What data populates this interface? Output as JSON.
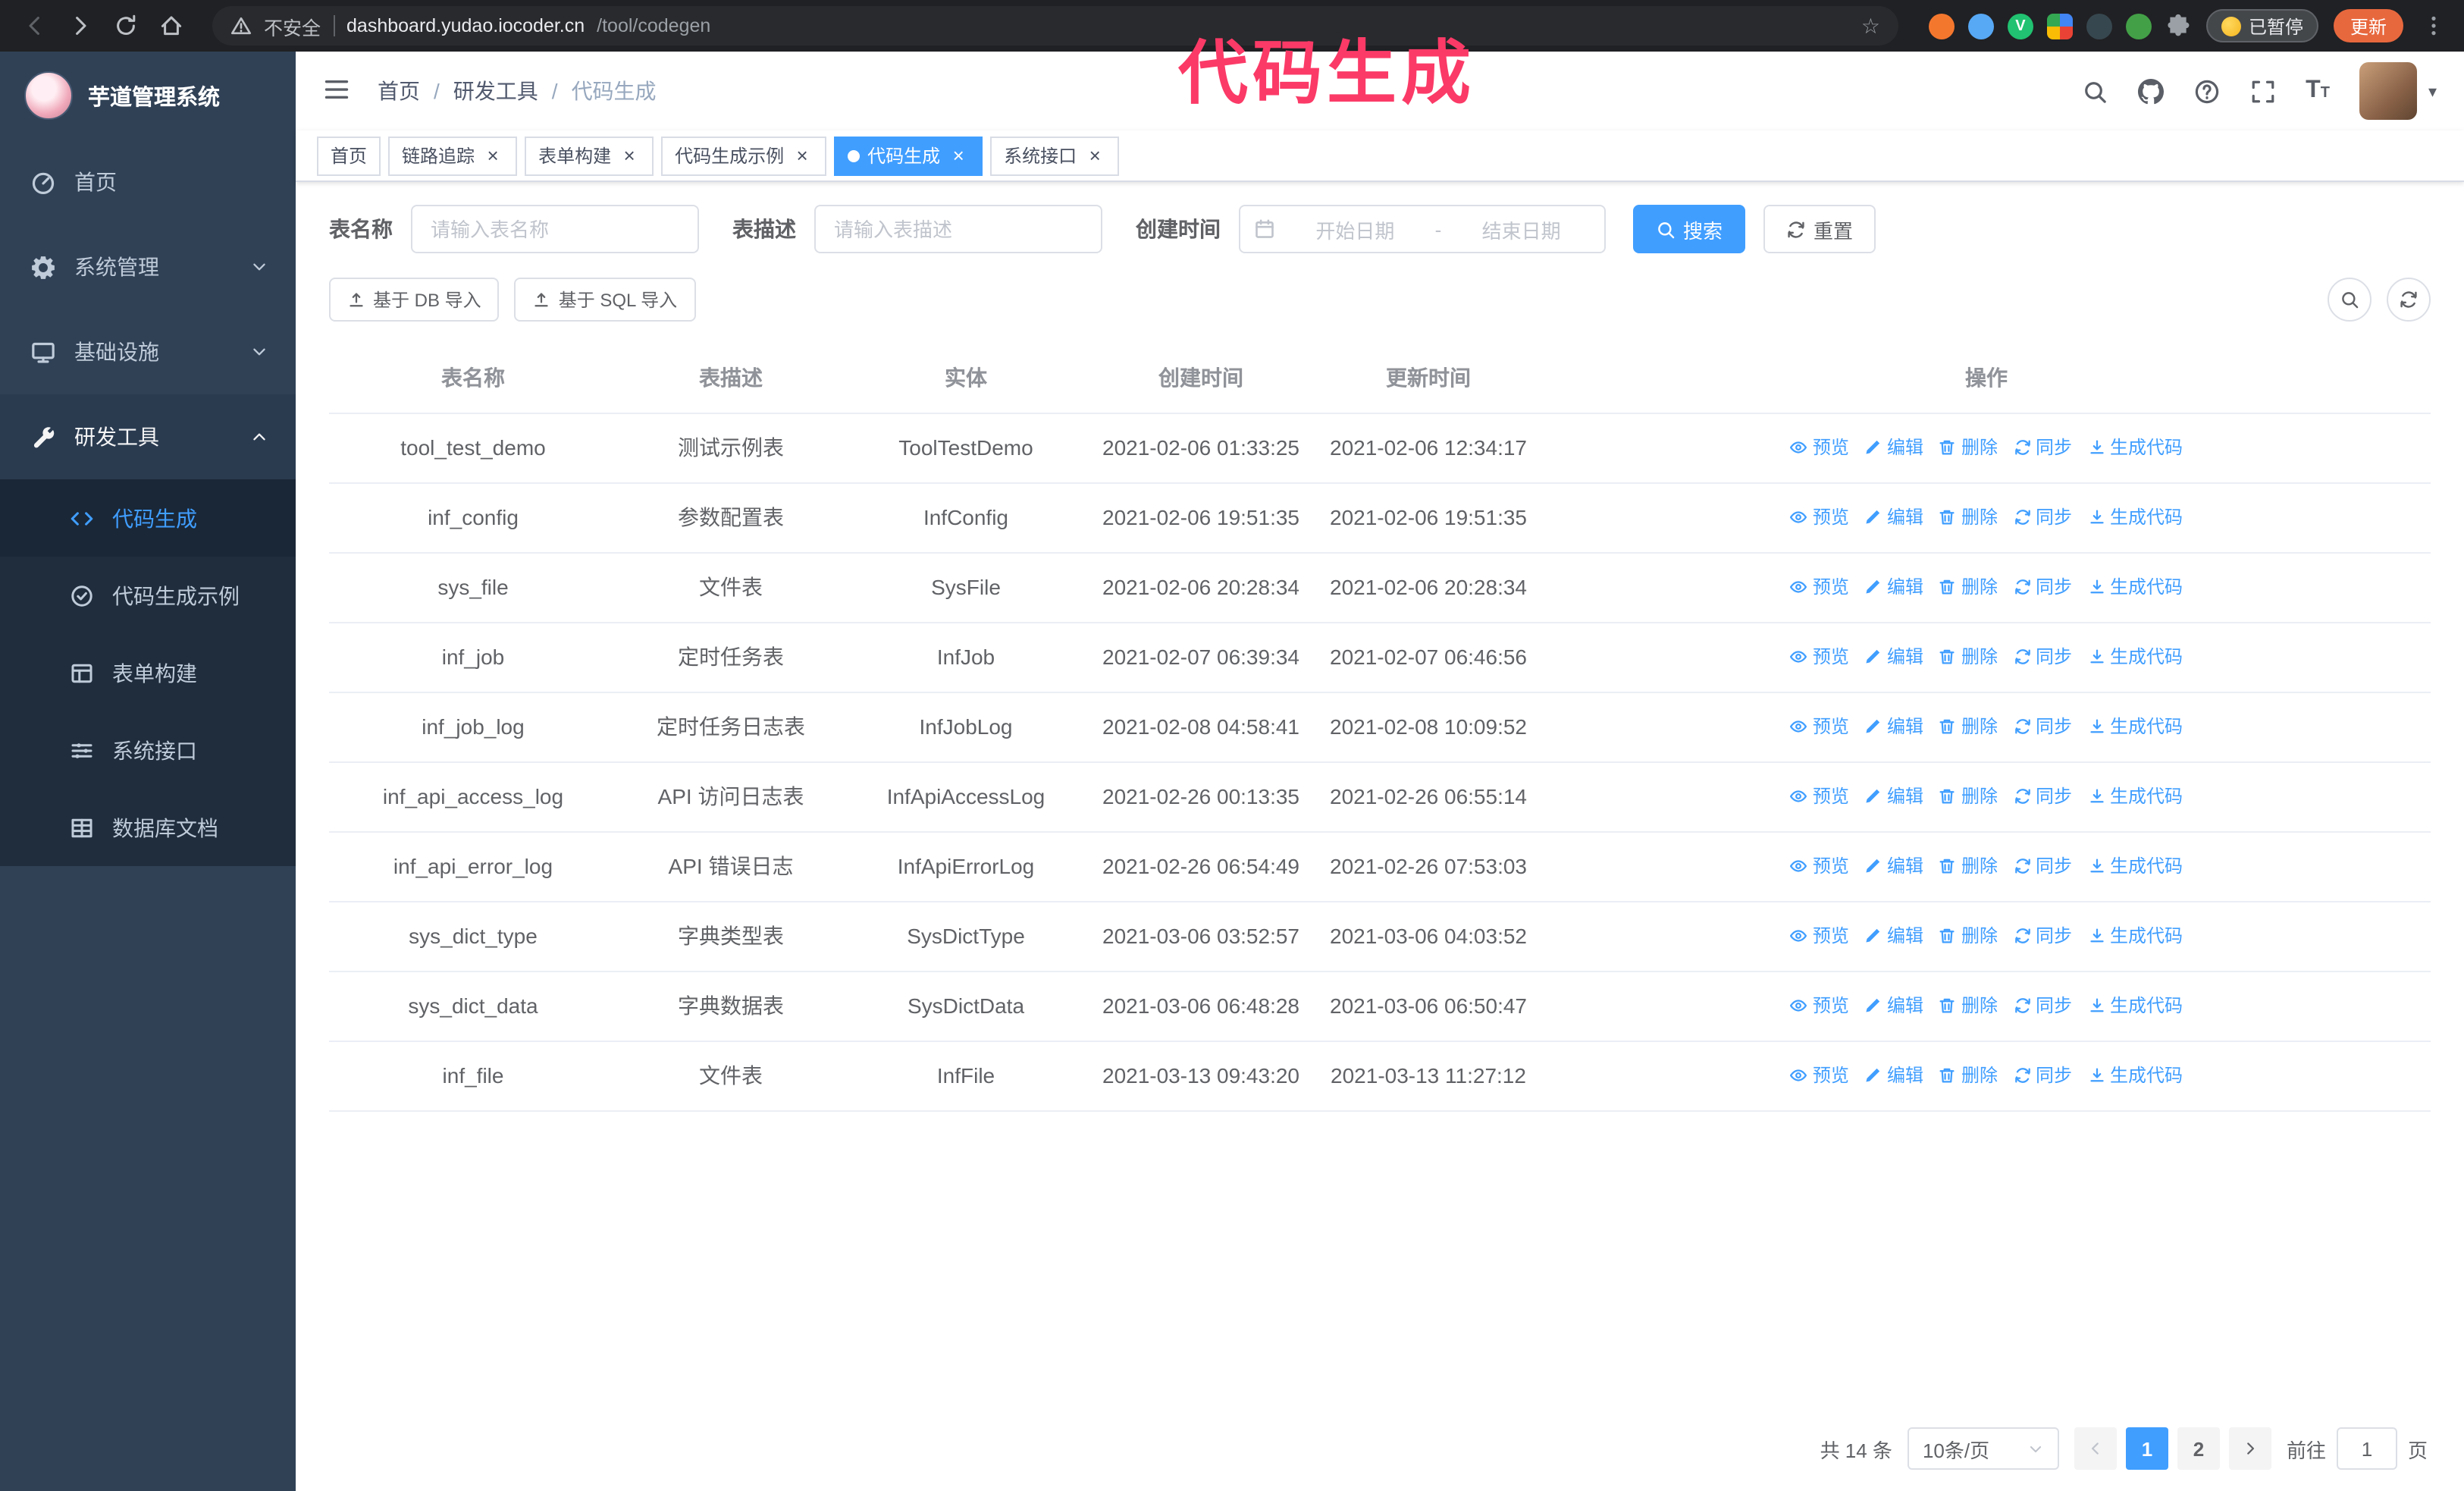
{
  "overlay": {
    "title": "代码生成"
  },
  "colors": {
    "accent": "#409eff",
    "sidebar_bg": "#304156",
    "submenu_bg": "#1f2d3d",
    "tab_active_bg": "#409eff",
    "overlay_pink": "#fb3a67",
    "update_button_bg": "#e8683e",
    "link_blue": "#409eff"
  },
  "icons": {
    "close": "×",
    "caret_down": "▾",
    "star": "☆",
    "separator": "/",
    "font_large": "T",
    "font_small": "T"
  },
  "browser": {
    "security_label": "不安全",
    "url_host": "dashboard.yudao.iocoder.cn",
    "url_path": "/tool/codegen",
    "paused_badge": "已暂停",
    "update_button": "更新",
    "extensions": [
      {
        "name": "extension-orange",
        "type": "color",
        "color": "#f4772e"
      },
      {
        "name": "extension-blue-drop",
        "type": "color",
        "color": "#57a8f5"
      },
      {
        "name": "extension-green-v",
        "type": "color",
        "color": "#21c271",
        "letter": "V"
      },
      {
        "name": "extension-colorful-grid",
        "type": "grid"
      },
      {
        "name": "extension-dark",
        "type": "color",
        "color": "#37474f"
      },
      {
        "name": "extension-green",
        "type": "color",
        "color": "#43a047"
      },
      {
        "name": "extension-puzzle",
        "type": "puzzle"
      }
    ]
  },
  "sidebar": {
    "logo_title": "芋道管理系统",
    "items": [
      {
        "label": "首页",
        "icon": "dashboard-icon"
      },
      {
        "label": "系统管理",
        "icon": "gear-icon",
        "chevron": "down"
      },
      {
        "label": "基础设施",
        "icon": "monitor-icon",
        "chevron": "down"
      },
      {
        "label": "研发工具",
        "icon": "tools-icon",
        "chevron": "up",
        "open": true
      }
    ],
    "subitems": [
      {
        "label": "代码生成",
        "icon": "code-icon",
        "active": true
      },
      {
        "label": "代码生成示例",
        "icon": "example-icon"
      },
      {
        "label": "表单构建",
        "icon": "form-icon"
      },
      {
        "label": "系统接口",
        "icon": "api-icon"
      },
      {
        "label": "数据库文档",
        "icon": "database-icon"
      }
    ]
  },
  "navbar": {
    "breadcrumb": [
      "首页",
      "研发工具",
      "代码生成"
    ]
  },
  "tabs": [
    {
      "label": "首页",
      "closable": false,
      "active": false
    },
    {
      "label": "链路追踪",
      "closable": true,
      "active": false
    },
    {
      "label": "表单构建",
      "closable": true,
      "active": false
    },
    {
      "label": "代码生成示例",
      "closable": true,
      "active": false
    },
    {
      "label": "代码生成",
      "closable": true,
      "active": true
    },
    {
      "label": "系统接口",
      "closable": true,
      "active": false
    }
  ],
  "filters": {
    "table_name_label": "表名称",
    "table_name_placeholder": "请输入表名称",
    "table_desc_label": "表描述",
    "table_desc_placeholder": "请输入表描述",
    "create_time_label": "创建时间",
    "date_start_placeholder": "开始日期",
    "date_separator": "-",
    "date_end_placeholder": "结束日期",
    "search_label": "搜索",
    "reset_label": "重置"
  },
  "toolbar": {
    "import_db_label": "基于 DB 导入",
    "import_sql_label": "基于 SQL 导入"
  },
  "table": {
    "columns": [
      "表名称",
      "表描述",
      "实体",
      "创建时间",
      "更新时间",
      "操作"
    ],
    "row_actions": [
      {
        "label": "预览",
        "icon": "eye-icon"
      },
      {
        "label": "编辑",
        "icon": "edit-icon"
      },
      {
        "label": "删除",
        "icon": "delete-icon"
      },
      {
        "label": "同步",
        "icon": "sync-icon"
      },
      {
        "label": "生成代码",
        "icon": "download-icon"
      }
    ],
    "rows": [
      {
        "name": "tool_test_demo",
        "desc": "测试示例表",
        "entity": "ToolTestDemo",
        "created": "2021-02-06 01:33:25",
        "updated": "2021-02-06 12:34:17"
      },
      {
        "name": "inf_config",
        "desc": "参数配置表",
        "entity": "InfConfig",
        "created": "2021-02-06 19:51:35",
        "updated": "2021-02-06 19:51:35"
      },
      {
        "name": "sys_file",
        "desc": "文件表",
        "entity": "SysFile",
        "created": "2021-02-06 20:28:34",
        "updated": "2021-02-06 20:28:34"
      },
      {
        "name": "inf_job",
        "desc": "定时任务表",
        "entity": "InfJob",
        "created": "2021-02-07 06:39:34",
        "updated": "2021-02-07 06:46:56"
      },
      {
        "name": "inf_job_log",
        "desc": "定时任务日志表",
        "entity": "InfJobLog",
        "created": "2021-02-08 04:58:41",
        "updated": "2021-02-08 10:09:52"
      },
      {
        "name": "inf_api_access_log",
        "desc": "API 访问日志表",
        "entity": "InfApiAccessLog",
        "created": "2021-02-26 00:13:35",
        "updated": "2021-02-26 06:55:14"
      },
      {
        "name": "inf_api_error_log",
        "desc": "API 错误日志",
        "entity": "InfApiErrorLog",
        "created": "2021-02-26 06:54:49",
        "updated": "2021-02-26 07:53:03"
      },
      {
        "name": "sys_dict_type",
        "desc": "字典类型表",
        "entity": "SysDictType",
        "created": "2021-03-06 03:52:57",
        "updated": "2021-03-06 04:03:52"
      },
      {
        "name": "sys_dict_data",
        "desc": "字典数据表",
        "entity": "SysDictData",
        "created": "2021-03-06 06:48:28",
        "updated": "2021-03-06 06:50:47"
      },
      {
        "name": "inf_file",
        "desc": "文件表",
        "entity": "InfFile",
        "created": "2021-03-13 09:43:20",
        "updated": "2021-03-13 11:27:12"
      }
    ]
  },
  "pagination": {
    "total_label": "共 14 条",
    "page_size_label": "10条/页",
    "pages": [
      "1",
      "2"
    ],
    "active_page": "1",
    "goto_label": "前往",
    "goto_value": "1",
    "goto_unit": "页"
  }
}
